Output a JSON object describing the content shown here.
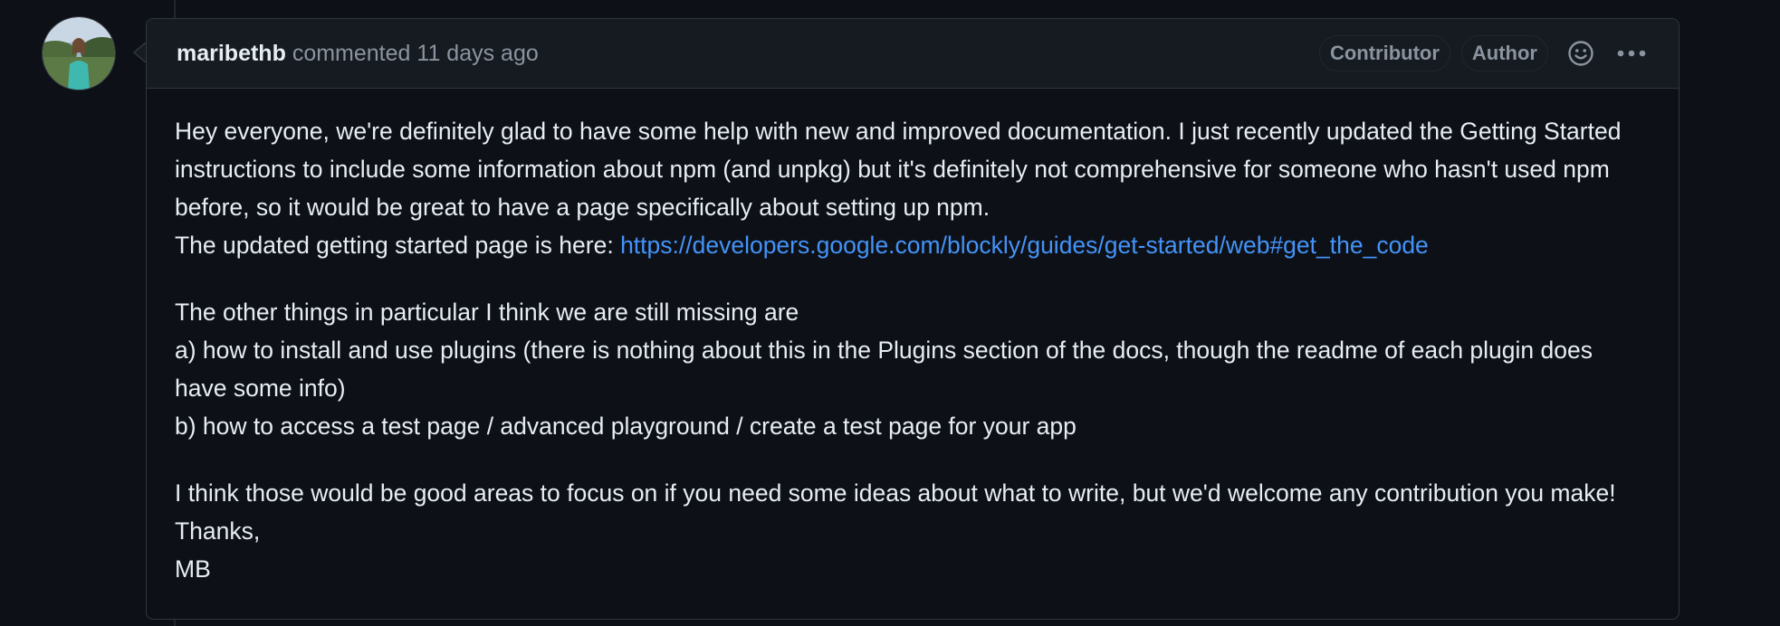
{
  "comment": {
    "author": "maribethb",
    "action": "commented",
    "timestamp": "11 days ago",
    "badges": [
      "Contributor",
      "Author"
    ],
    "icons": {
      "reaction": "smiley-icon",
      "more": "kebab-horizontal-icon"
    },
    "paragraphs": [
      {
        "lines": [
          "Hey everyone, we're definitely glad to have some help with new and improved documentation. I just recently updated the Getting Started instructions to include some information about npm (and unpkg) but it's definitely not comprehensive for someone who hasn't used npm before, so it would be great to have a page specifically about setting up npm."
        ],
        "link_prefix": "The updated getting started page is here: ",
        "link_text": "https://developers.google.com/blockly/guides/get-started/web#get_the_code"
      },
      {
        "lines": [
          "The other things in particular I think we are still missing are",
          "a) how to install and use plugins (there is nothing about this in the Plugins section of the docs, though the readme of each plugin does have some info)",
          "b) how to access a test page / advanced playground / create a test page for your app"
        ]
      },
      {
        "lines": [
          "I think those would be good areas to focus on if you need some ideas about what to write, but we'd welcome any contribution you make! Thanks,",
          "MB"
        ]
      }
    ]
  },
  "colors": {
    "background": "#0d1117",
    "header_background": "#161b22",
    "border": "#30363d",
    "text": "#e6edf3",
    "muted": "#8b949e",
    "link": "#4493f8"
  }
}
